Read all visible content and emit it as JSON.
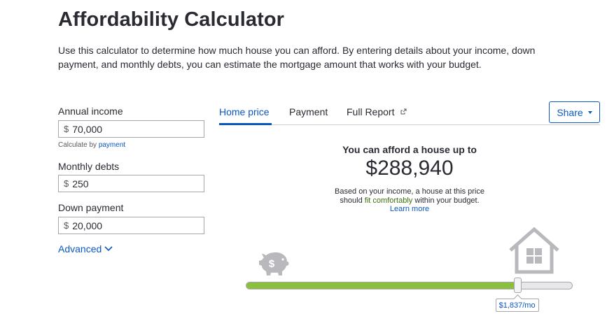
{
  "header": {
    "title": "Affordability Calculator",
    "description": "Use this calculator to determine how much house you can afford. By entering details about your income, down payment, and monthly debts, you can estimate the mortgage amount that works with your budget."
  },
  "form": {
    "annual_income": {
      "label": "Annual income",
      "currency": "$",
      "value": "70,000"
    },
    "calculate_by": {
      "prefix": "Calculate by",
      "link": "payment"
    },
    "monthly_debts": {
      "label": "Monthly debts",
      "currency": "$",
      "value": "250"
    },
    "down_payment": {
      "label": "Down payment",
      "currency": "$",
      "value": "20,000"
    },
    "advanced_label": "Advanced"
  },
  "tabs": [
    {
      "label": "Home price",
      "active": true
    },
    {
      "label": "Payment",
      "active": false
    },
    {
      "label": "Full Report",
      "active": false,
      "icon": "external-link-icon"
    }
  ],
  "share": {
    "label": "Share",
    "icon": "caret-down-icon"
  },
  "result": {
    "title": "You can afford a house up to",
    "price": "$288,940",
    "note_before": "Based on your income, a house at this price",
    "note_line2_start": "should",
    "note_highlight": "fit comfortably",
    "note_line2_end": "within your budget.",
    "learn_more": "Learn more"
  },
  "slider": {
    "level": 0.83,
    "payment_label": "$1,837/mo",
    "left_icon": "piggy-bank-icon",
    "right_icon": "house-icon"
  },
  "colors": {
    "accent": "#0b57c2",
    "fill": "#8bbf3f",
    "text": "#2a2a33",
    "icon_gray": "#b8b8bd",
    "highlight_green": "#3b6e0d"
  }
}
